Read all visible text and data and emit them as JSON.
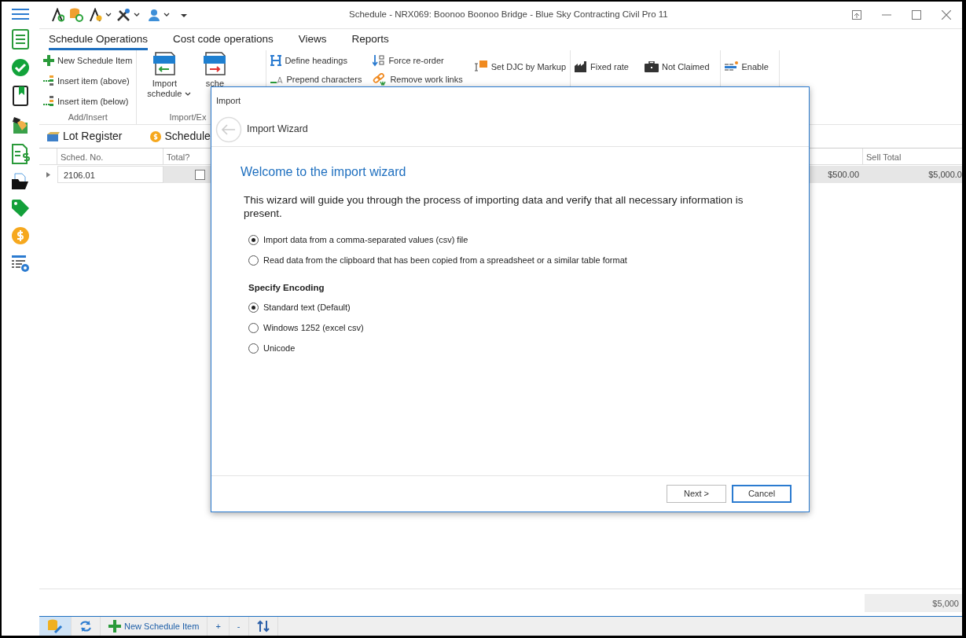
{
  "window": {
    "title": "Schedule - NRX069: Boonoo Boonoo Bridge  - Blue Sky Contracting Civil Pro 11"
  },
  "ribbon_tabs": [
    {
      "label": "Schedule Operations",
      "selected": true
    },
    {
      "label": "Cost code operations",
      "selected": false
    },
    {
      "label": "Views",
      "selected": false
    },
    {
      "label": "Reports",
      "selected": false
    }
  ],
  "ribbon_groups": [
    {
      "label": "Add/Insert",
      "items": [
        {
          "label": "New Schedule Item"
        },
        {
          "label": "Insert item (above)"
        },
        {
          "label": "Insert item (below)"
        }
      ]
    },
    {
      "label": "Import/Ex",
      "items": [
        {
          "label": "Import schedule"
        },
        {
          "label": "sche"
        }
      ]
    },
    {
      "items": [
        {
          "label": "Define headings"
        },
        {
          "label": "Prepend characters"
        },
        {
          "label": "Force re-order"
        },
        {
          "label": "Remove work links"
        },
        {
          "label": "Set DJC by Markup"
        }
      ]
    },
    {
      "items": [
        {
          "label": "Fixed rate"
        },
        {
          "label": "Not Claimed"
        }
      ]
    },
    {
      "items": [
        {
          "label": "Enable"
        }
      ]
    }
  ],
  "doc_tabs": [
    {
      "label": "Lot Register"
    },
    {
      "label": "Schedule"
    }
  ],
  "table": {
    "columns": [
      "Sched. No.",
      "Total?",
      "Sell Total"
    ],
    "rows": [
      {
        "sched_no": "2106.01",
        "total_checked": false,
        "column_4": "$500.00",
        "sell_total": "$5,000.0"
      }
    ],
    "footer_total": "$5,000"
  },
  "bottom_toolbar": {
    "items": [
      {
        "label": "New Schedule Item"
      },
      {
        "label": "+"
      },
      {
        "label": "-"
      }
    ]
  },
  "dialog": {
    "title": "Import",
    "header": "Import Wizard",
    "heading": "Welcome to the import wizard",
    "intro": "This wizard will guide you through the process of importing data and verify that all necessary information is present.",
    "source_options": [
      {
        "label": "Import data from a comma-separated values (csv) file",
        "selected": true
      },
      {
        "label": "Read data from the clipboard that has been copied from a spreadsheet or a similar table format",
        "selected": false
      }
    ],
    "encoding_title": "Specify Encoding",
    "encoding_options": [
      {
        "label": "Standard text (Default)",
        "selected": true
      },
      {
        "label": "Windows 1252 (excel csv)",
        "selected": false
      },
      {
        "label": "Unicode",
        "selected": false
      }
    ],
    "buttons": [
      {
        "label": "Next >",
        "primary": false
      },
      {
        "label": "Cancel",
        "primary": true
      }
    ]
  }
}
